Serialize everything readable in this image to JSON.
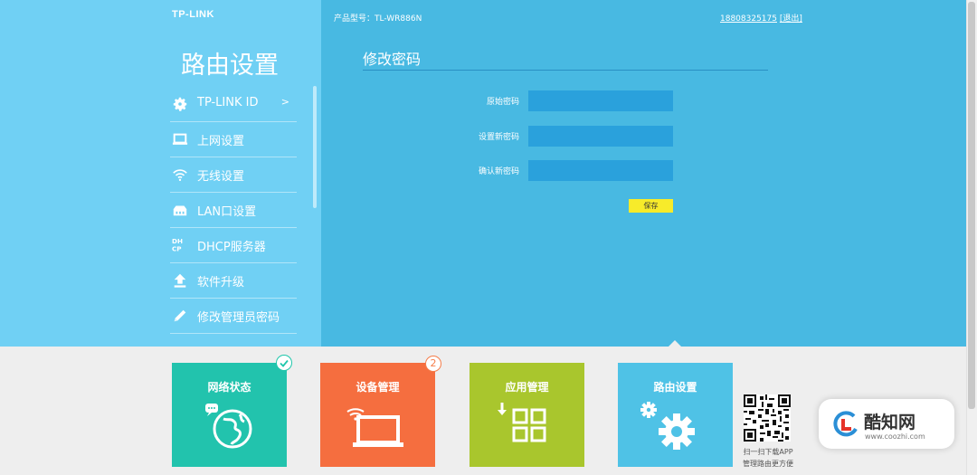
{
  "brand": "TP-LINK",
  "header": {
    "model_label": "产品型号：TL-WR886N",
    "user_phone": "18808325175",
    "logout": "[退出]"
  },
  "sidebar": {
    "title": "路由设置",
    "items": [
      {
        "label": "TP-LINK ID",
        "icon": "gear-icon",
        "arrow": ">"
      },
      {
        "label": "上网设置",
        "icon": "laptop-icon"
      },
      {
        "label": "无线设置",
        "icon": "wifi-icon"
      },
      {
        "label": "LAN口设置",
        "icon": "lan-port-icon"
      },
      {
        "label": "DHCP服务器",
        "icon": "dhcp-icon"
      },
      {
        "label": "软件升级",
        "icon": "upgrade-arrow-icon"
      },
      {
        "label": "修改管理员密码",
        "icon": "pencil-icon"
      }
    ]
  },
  "form": {
    "title": "修改密码",
    "fields": [
      {
        "label": "原始密码",
        "value": ""
      },
      {
        "label": "设置新密码",
        "value": ""
      },
      {
        "label": "确认新密码",
        "value": ""
      }
    ],
    "save_label": "保存"
  },
  "tiles": [
    {
      "label": "网络状态",
      "color": "#22c3ad",
      "icon": "globe-icon"
    },
    {
      "label": "设备管理",
      "color": "#f56e3f",
      "icon": "laptop-wifi-icon",
      "badge": "2"
    },
    {
      "label": "应用管理",
      "color": "#a9c62d",
      "icon": "apps-grid-icon"
    },
    {
      "label": "路由设置",
      "color": "#4fc2e6",
      "icon": "gears-icon"
    }
  ],
  "app_promo": {
    "line1": "扫一扫下载APP",
    "line2": "管理路由更方便"
  },
  "watermark": {
    "name": "酷知网",
    "url": "www.coozhi.com"
  },
  "colors": {
    "main_bg": "#48b9e2",
    "sidebar_bg": "#70d0f4",
    "input_bg": "#2aa1dc",
    "save_button": "#f7eb2a"
  }
}
